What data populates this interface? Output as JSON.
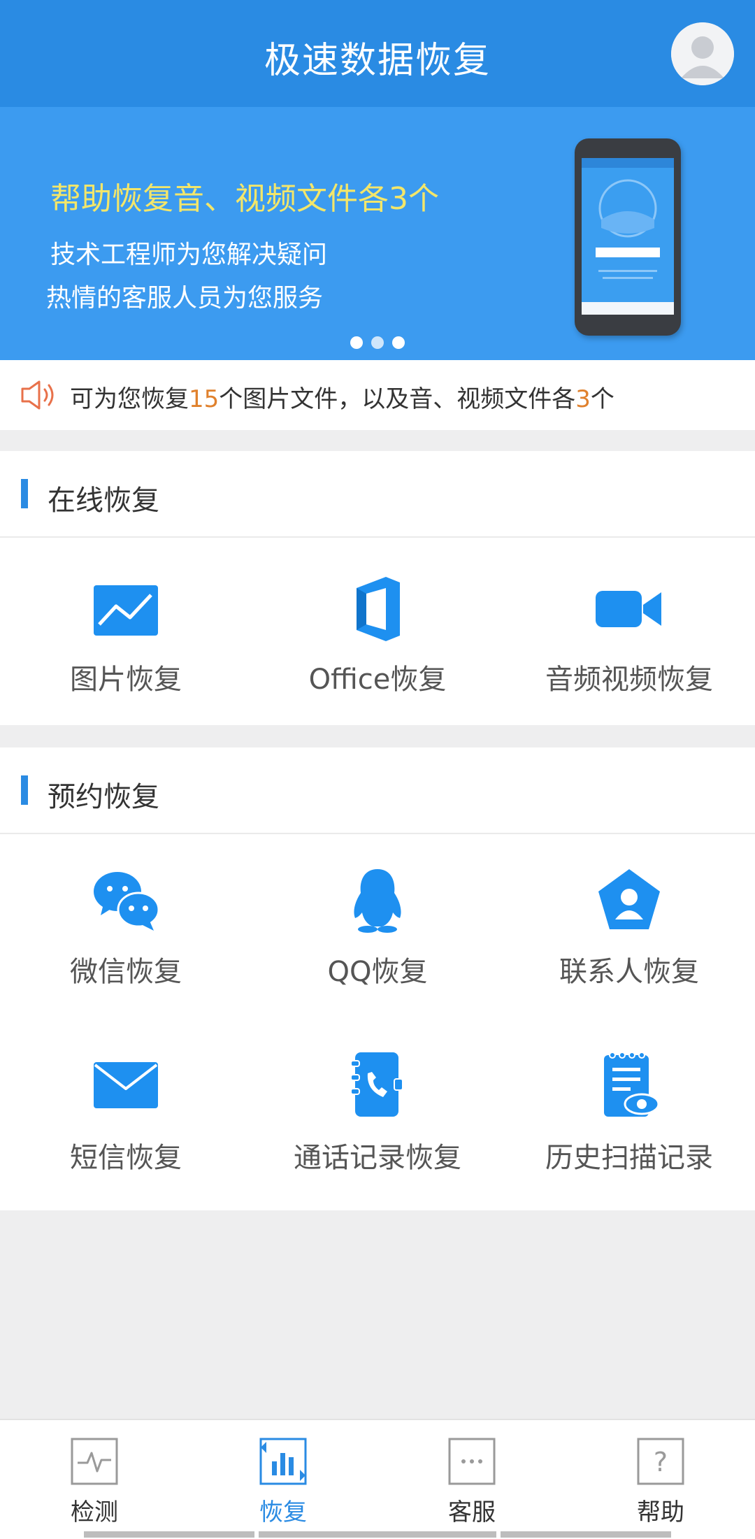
{
  "header": {
    "title": "极速数据恢复",
    "avatar_icon": "user-avatar-icon"
  },
  "banner": {
    "line1": "帮助恢复音、视频文件各3个",
    "line2": "技术工程师为您解决疑问",
    "line3": "热情的客服人员为您服务",
    "pager_count": 3,
    "pager_active": 1
  },
  "notice": {
    "pre": "可为您恢复",
    "n1": "15",
    "mid": "个图片文件，以及音、视频文件各",
    "n2": "3",
    "post": "个"
  },
  "online": {
    "title": "在线恢复",
    "items": [
      {
        "label": "图片恢复",
        "icon": "image-icon"
      },
      {
        "label": "Office恢复",
        "icon": "office-icon"
      },
      {
        "label": "音频视频恢复",
        "icon": "video-camera-icon"
      }
    ]
  },
  "booking": {
    "title": "预约恢复",
    "items": [
      {
        "label": "微信恢复",
        "icon": "wechat-icon"
      },
      {
        "label": "QQ恢复",
        "icon": "qq-penguin-icon"
      },
      {
        "label": "联系人恢复",
        "icon": "contact-icon"
      },
      {
        "label": "短信恢复",
        "icon": "envelope-icon"
      },
      {
        "label": "通话记录恢复",
        "icon": "call-log-icon"
      },
      {
        "label": "历史扫描记录",
        "icon": "scan-history-icon"
      }
    ]
  },
  "tabs": [
    {
      "label": "检测",
      "icon": "pulse-icon"
    },
    {
      "label": "恢复",
      "icon": "bar-chart-icon"
    },
    {
      "label": "客服",
      "icon": "chat-dots-icon"
    },
    {
      "label": "帮助",
      "icon": "question-icon"
    }
  ],
  "colors": {
    "primary": "#2a8be3",
    "banner": "#3c9bf0",
    "accent_number": "#e0812d",
    "highlight_text": "#f3e66a"
  }
}
